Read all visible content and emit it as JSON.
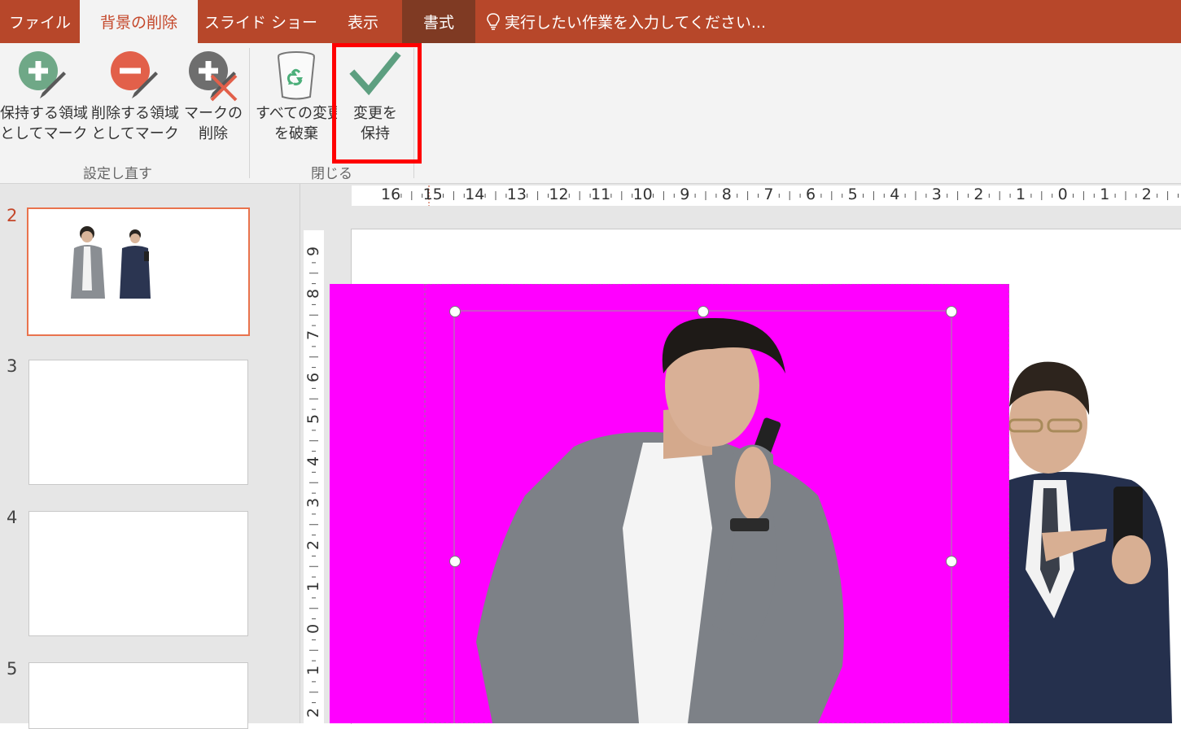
{
  "tabs": [
    {
      "label": "ファイル"
    },
    {
      "label": "背景の削除"
    },
    {
      "label": "スライド ショー"
    },
    {
      "label": "表示"
    },
    {
      "label": "書式"
    }
  ],
  "tell_me": "実行したい作業を入力してください...",
  "ribbon": {
    "buttons": [
      {
        "line1": "保持する領域",
        "line2": "としてマーク"
      },
      {
        "line1": "削除する領域",
        "line2": "としてマーク"
      },
      {
        "line1": "マークの",
        "line2": "削除"
      },
      {
        "line1": "すべての変更",
        "line2": "を破棄"
      },
      {
        "line1": "変更を",
        "line2": "保持"
      }
    ],
    "groups": [
      "設定し直す",
      "閉じる"
    ]
  },
  "slides": [
    "2",
    "3",
    "4",
    "5"
  ],
  "ruler": {
    "horizontal": [
      "16",
      "15",
      "14",
      "13",
      "12",
      "11",
      "10",
      "9",
      "8",
      "7",
      "6",
      "5",
      "4",
      "3",
      "2",
      "1",
      "0",
      "1",
      "2"
    ],
    "vertical": [
      "9",
      "8",
      "7",
      "6",
      "5",
      "4",
      "3",
      "2",
      "1",
      "0",
      "1",
      "2"
    ]
  },
  "colors": {
    "accent": "#b7472a",
    "removal_overlay": "#ff00ff",
    "highlight": "#ff0000"
  }
}
